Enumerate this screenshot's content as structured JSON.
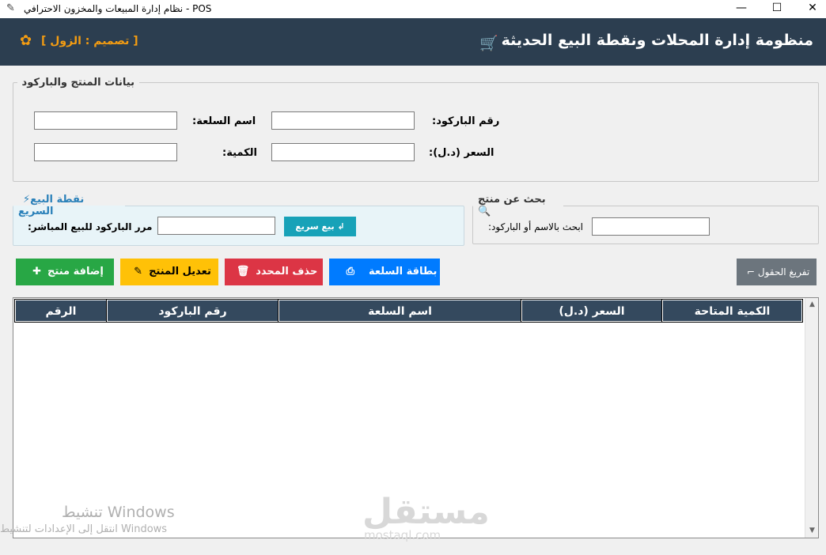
{
  "window": {
    "title": "POS - نظام إدارة المبيعات والمخزون الاحترافي",
    "minimize": "—",
    "maximize": "☐",
    "close": "✕"
  },
  "header": {
    "title": "منظومة إدارة المحلات ونقطة البيع الحديثة",
    "designer": "[ تصميم : الزول ]",
    "cart_icon": "cart-icon",
    "designer_icon": "gear-flower-icon"
  },
  "product_group": {
    "legend": "بيانات المنتج والباركود",
    "barcode_label": "رقم الباركود:",
    "name_label": "اسم السلعة:",
    "price_label": "السعر (د.ل):",
    "qty_label": "الكمية:",
    "barcode_value": "",
    "name_value": "",
    "price_value": "",
    "qty_value": ""
  },
  "quick_sale": {
    "legend": "نقطة البيع السريع",
    "label": "مرر الباركود للبيع المباشر:",
    "value": "",
    "button": "بيع سريع"
  },
  "search": {
    "legend": "بحث عن منتج",
    "label": "ابحث بالاسم أو الباركود:",
    "value": ""
  },
  "actions": {
    "add": "إضافة منتج",
    "edit": "تعديل المنتج",
    "delete": "حذف المحدد",
    "card": "بطاقة السلعة",
    "clear": "تفريغ الحقول"
  },
  "table": {
    "columns": [
      "الكمية المتاحة",
      "السعر (د.ل)",
      "اسم السلعة",
      "رقم الباركود",
      "الرقم"
    ],
    "rows": []
  },
  "watermark": {
    "line1": "تنشيط Windows",
    "line2": "انتقل إلى الإعدادات لتنشيط Windows",
    "logo": "مستقل",
    "logo_sub": "mostaql.com"
  }
}
